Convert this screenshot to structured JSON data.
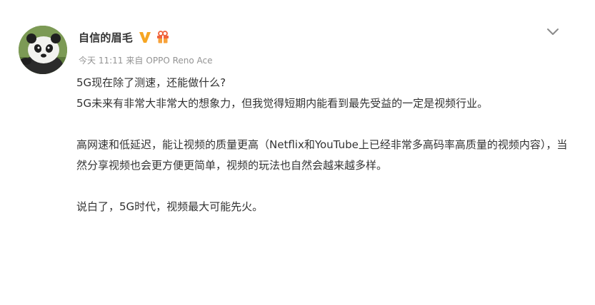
{
  "post": {
    "username": "自信的眉毛",
    "time": "今天 11:11",
    "source_prefix": "来自",
    "device": "OPPO Reno Ace",
    "paragraphs": [
      "5G现在除了测速，还能做什么?",
      "5G未来有非常大非常大的想象力，但我觉得短期内能看到最先受益的一定是视频行业。",
      "高网速和低延迟，能让视频的质量更高（Netflix和YouTube上已经非常多高码率高质量的视频内容），当然分享视频也会更方便更简单，视频的玩法也自然会越来越多样。",
      "说白了，5G时代，视频最大可能先火。"
    ]
  },
  "icons": {
    "avatar": "panda-avatar",
    "verified": "verified-v-icon",
    "badge": "gift-badge-icon",
    "menu": "chevron-down-icon"
  },
  "colors": {
    "text": "#333333",
    "meta": "#939393",
    "verified": "#f6a623",
    "badge": "#f0633b"
  }
}
